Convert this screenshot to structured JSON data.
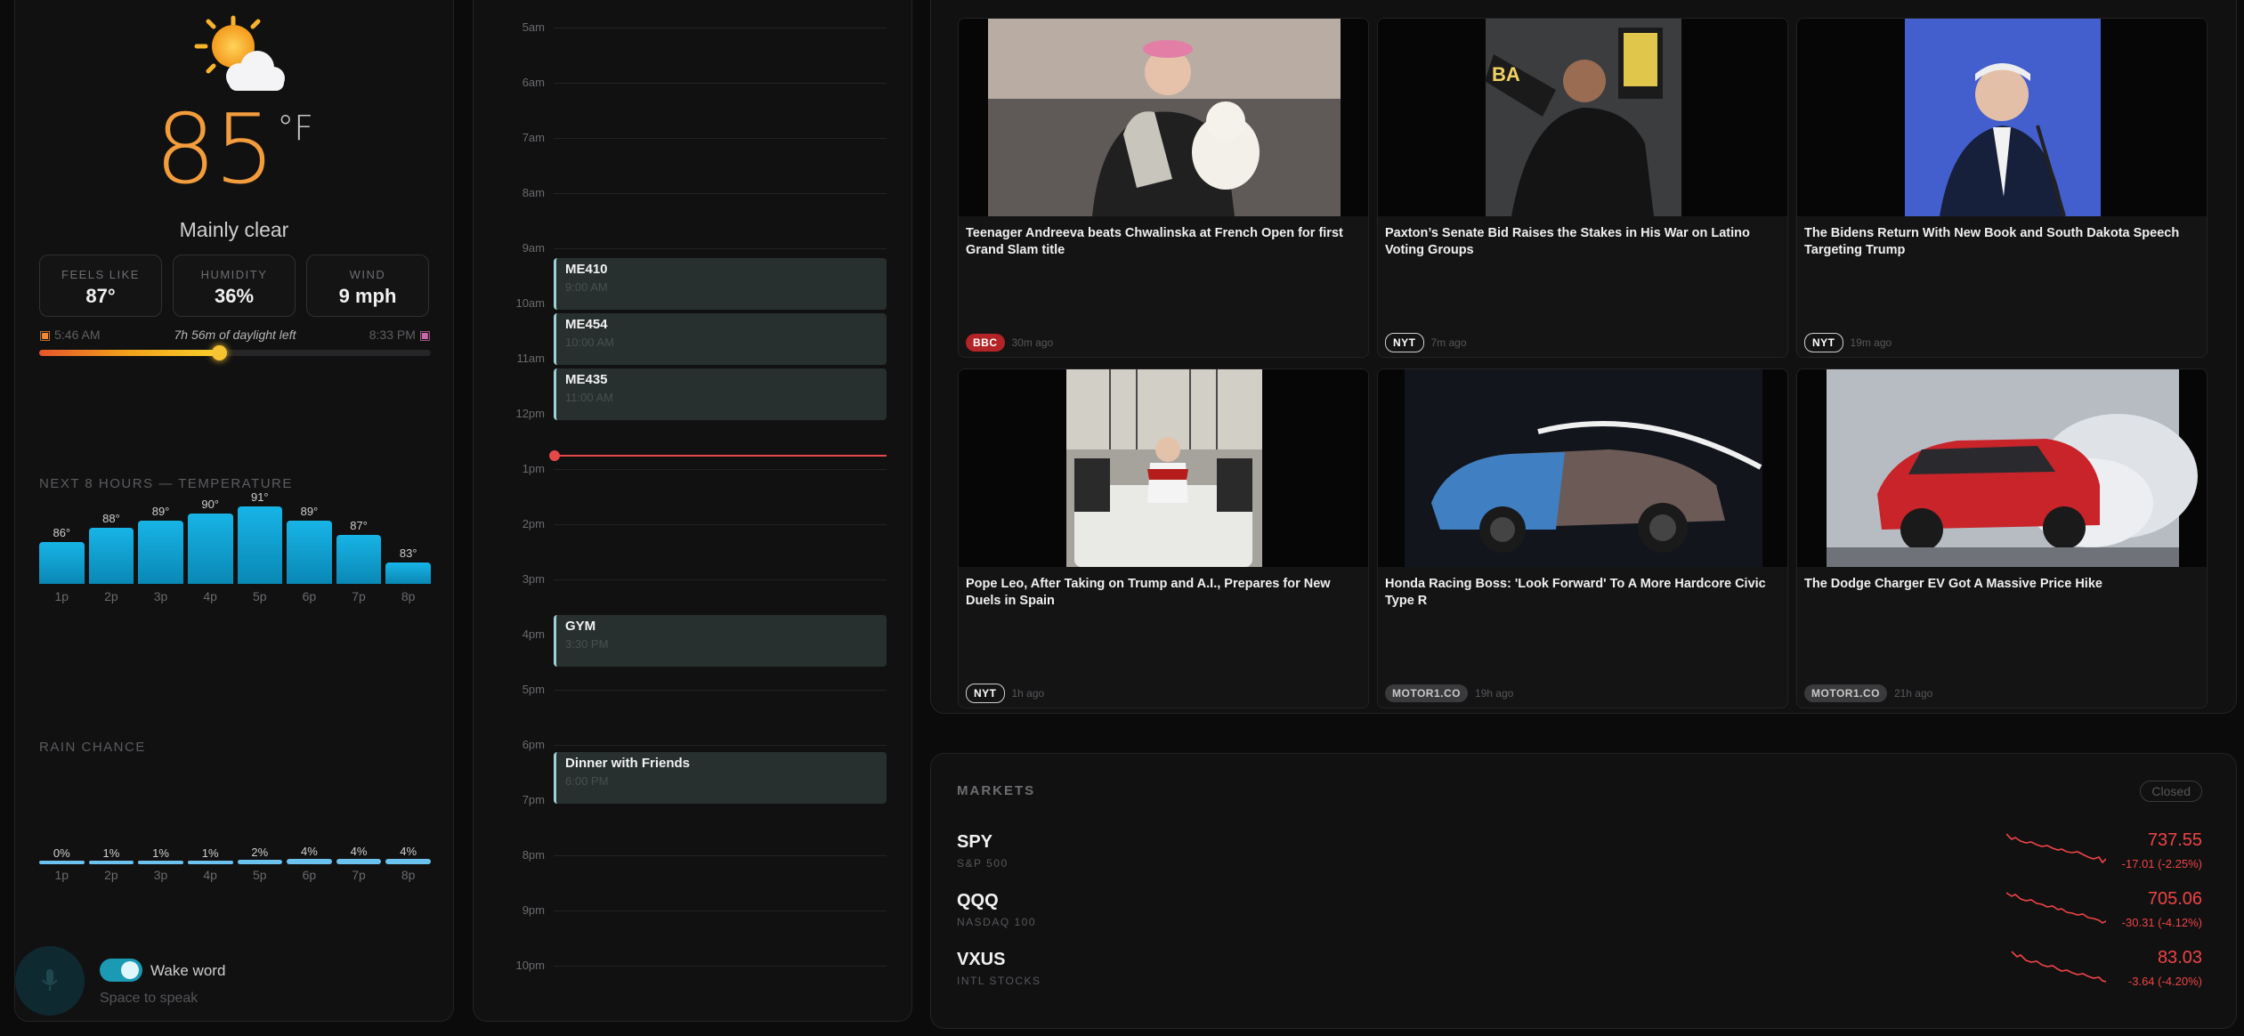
{
  "weather": {
    "temperature": "85",
    "unit": "°F",
    "condition": "Mainly clear",
    "feels_like": {
      "label": "FEELS LIKE",
      "value": "87°"
    },
    "humidity": {
      "label": "HUMIDITY",
      "value": "36%"
    },
    "wind": {
      "label": "WIND",
      "value": "9 mph"
    },
    "sunrise": "5:46 AM",
    "sunset": "8:33 PM",
    "daylight_left": "7h 56m of daylight left",
    "daylight_progress_fraction": 0.46,
    "hourly_title": "NEXT 8 HOURS — TEMPERATURE",
    "rain_title": "RAIN CHANCE",
    "wake_word_label": "Wake word",
    "space_hint": "Space to speak"
  },
  "chart_data": [
    {
      "type": "bar",
      "title": "NEXT 8 HOURS — TEMPERATURE",
      "categories": [
        "1p",
        "2p",
        "3p",
        "4p",
        "5p",
        "6p",
        "7p",
        "8p"
      ],
      "values": [
        86,
        88,
        89,
        90,
        91,
        89,
        87,
        83
      ],
      "value_labels": [
        "86°",
        "88°",
        "89°",
        "90°",
        "91°",
        "89°",
        "87°",
        "83°"
      ],
      "color": "#12a6d8"
    },
    {
      "type": "bar",
      "title": "RAIN CHANCE",
      "categories": [
        "1p",
        "2p",
        "3p",
        "4p",
        "5p",
        "6p",
        "7p",
        "8p"
      ],
      "values": [
        0,
        1,
        1,
        1,
        2,
        4,
        4,
        4
      ],
      "value_labels": [
        "0%",
        "1%",
        "1%",
        "1%",
        "2%",
        "4%",
        "4%",
        "4%"
      ],
      "color": "#6cc2ee"
    }
  ],
  "calendar": {
    "hours": [
      "5am",
      "6am",
      "7am",
      "8am",
      "9am",
      "10am",
      "11am",
      "12pm",
      "1pm",
      "2pm",
      "3pm",
      "4pm",
      "5pm",
      "6pm",
      "7pm",
      "8pm",
      "9pm",
      "10pm"
    ],
    "events": [
      {
        "title": "ME410",
        "time": "9:00 AM"
      },
      {
        "title": "ME454",
        "time": "10:00 AM"
      },
      {
        "title": "ME435",
        "time": "11:00 AM"
      },
      {
        "title": "GYM",
        "time": "3:30 PM"
      },
      {
        "title": "Dinner with Friends",
        "time": "6:00 PM"
      }
    ]
  },
  "news": [
    {
      "title": "Teenager Andreeva beats Chwalinska at French Open for first Grand Slam title",
      "source": "BBC",
      "age": "30m ago"
    },
    {
      "title": "Paxton’s Senate Bid Raises the Stakes in His War on Latino Voting Groups",
      "source": "NYT",
      "age": "7m ago"
    },
    {
      "title": "The Bidens Return With New Book and South Dakota Speech Targeting Trump",
      "source": "NYT",
      "age": "19m ago"
    },
    {
      "title": "Pope Leo, After Taking on Trump and A.I., Prepares for New Duels in Spain",
      "source": "NYT",
      "age": "1h ago"
    },
    {
      "title": "Honda Racing Boss: 'Look Forward' To A More Hardcore Civic Type R",
      "source": "MOTOR1.CO",
      "age": "19h ago"
    },
    {
      "title": "The Dodge Charger EV Got A Massive Price Hike",
      "source": "MOTOR1.CO",
      "age": "21h ago"
    }
  ],
  "markets": {
    "title": "MARKETS",
    "status": "Closed",
    "tickers": [
      {
        "symbol": "SPY",
        "name": "S&P 500",
        "price": "737.55",
        "change": "-17.01 (-2.25%)"
      },
      {
        "symbol": "QQQ",
        "name": "NASDAQ 100",
        "price": "705.06",
        "change": "-30.31 (-4.12%)"
      },
      {
        "symbol": "VXUS",
        "name": "INTL STOCKS",
        "price": "83.03",
        "change": "-3.64 (-4.20%)"
      }
    ],
    "negative_color": "#ef4444"
  }
}
